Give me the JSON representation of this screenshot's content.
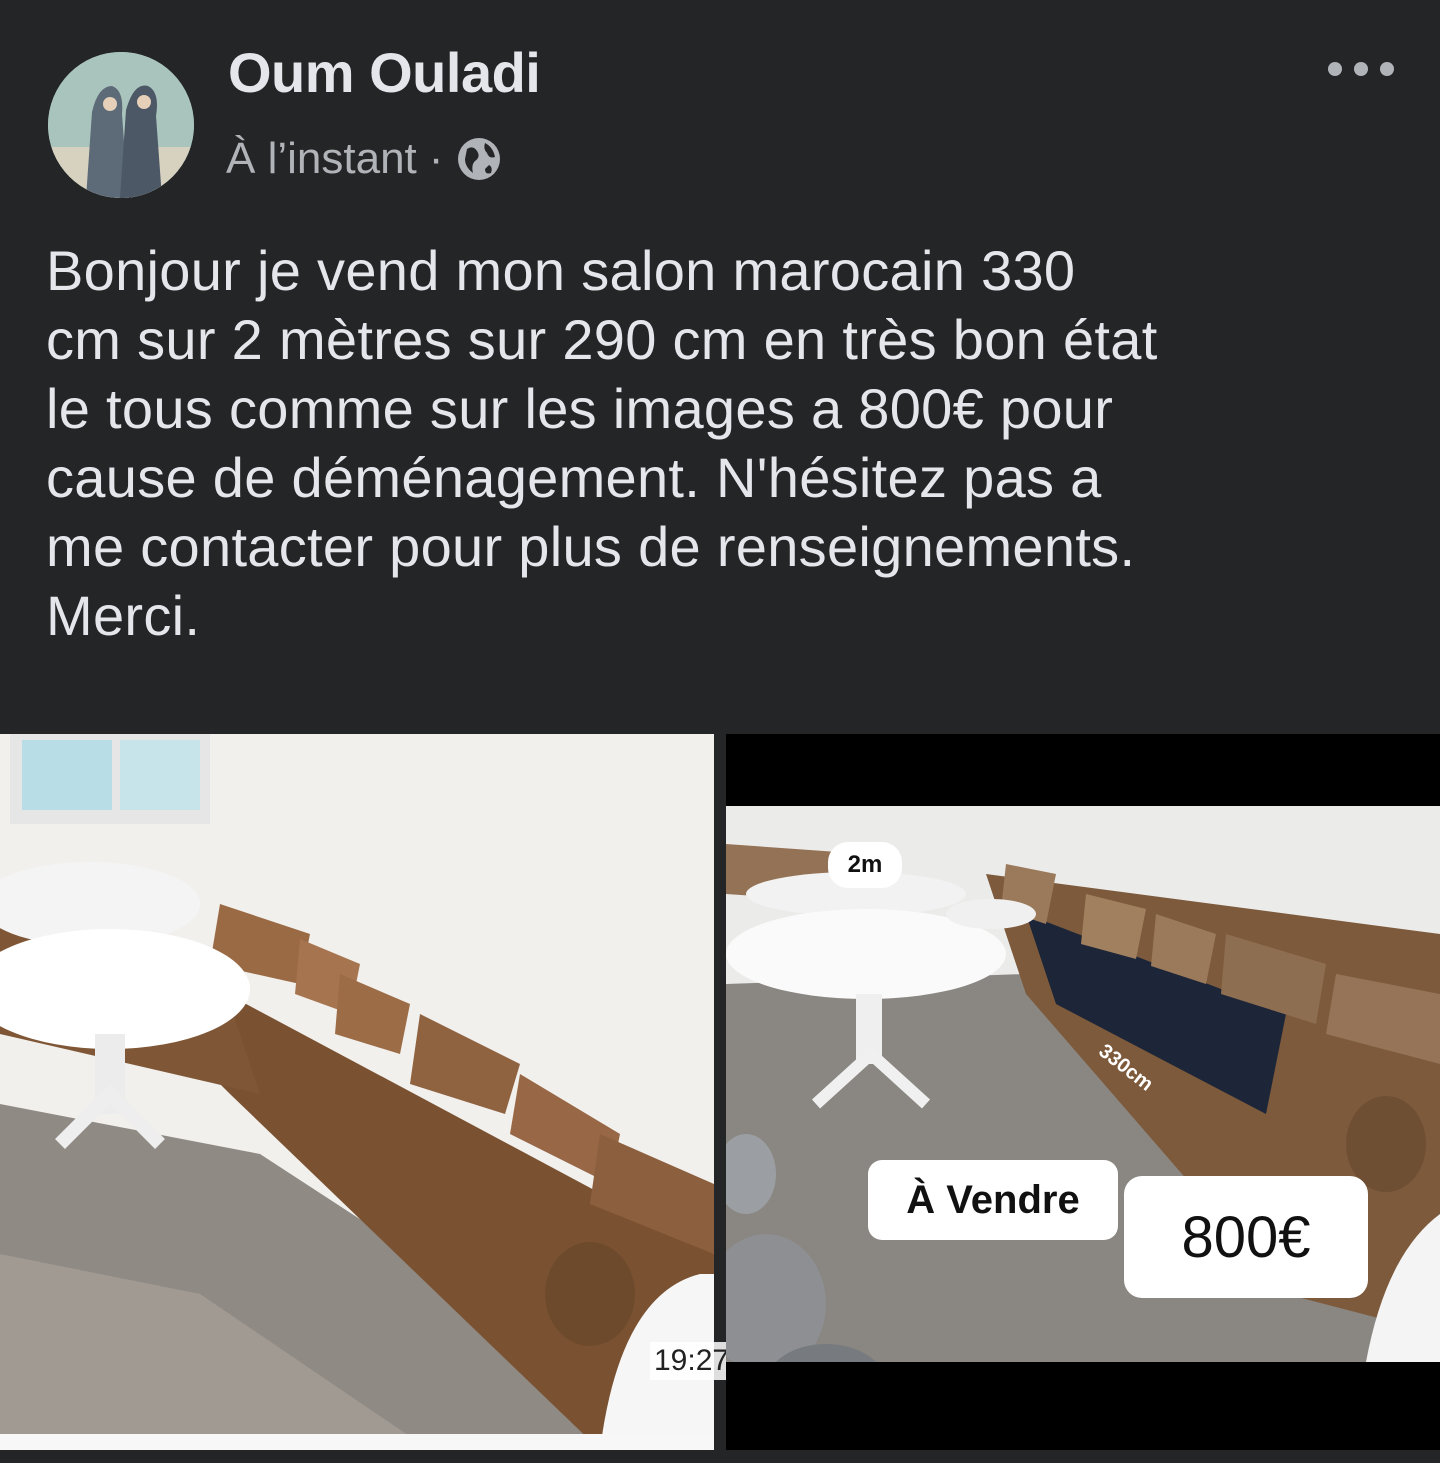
{
  "post": {
    "author_name": "Oum Ouladi",
    "timestamp": "À l’instant",
    "separator": "·",
    "privacy_icon": "globe-icon",
    "text_lines": [
      "Bonjour je vend mon salon marocain 330",
      "cm sur 2 mètres sur 290 cm en très bon état",
      "le tous comme sur les images a 800€ pour",
      "cause de déménagement. N'hésitez pas a",
      "me contacter pour plus de renseignements.",
      "Merci."
    ]
  },
  "photos": {
    "photo1": {
      "time_overlay": "19:27"
    },
    "photo2": {
      "dimension_label": "2m",
      "length_label": "330cm",
      "sale_label": "À Vendre",
      "price_label": "800€"
    }
  },
  "colors": {
    "background": "#242526",
    "text_primary": "#e4e6eb",
    "text_secondary": "#b0b3b8"
  }
}
